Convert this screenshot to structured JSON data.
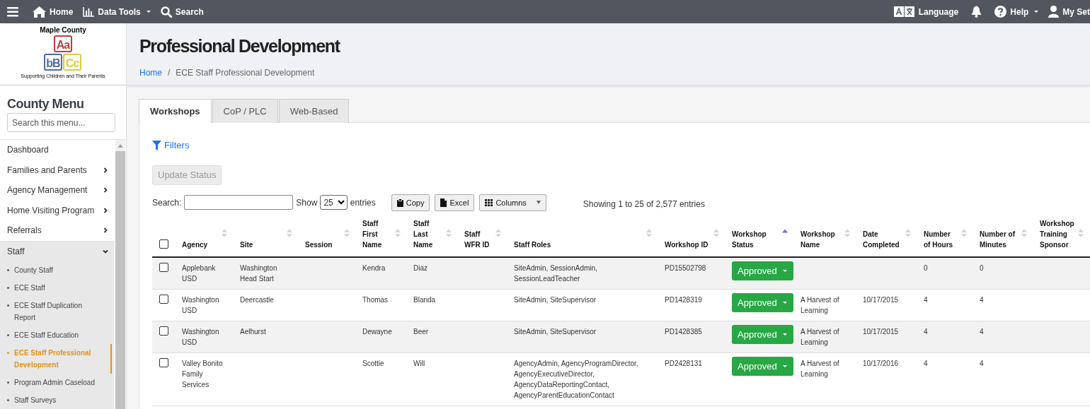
{
  "topbar": {
    "left": [
      {
        "kind": "home",
        "label": "Home",
        "dropdown": false
      },
      {
        "kind": "chart",
        "label": "Data Tools",
        "dropdown": true
      },
      {
        "kind": "search",
        "label": "Search",
        "dropdown": false
      }
    ],
    "right": [
      {
        "kind": "language",
        "label": "Language"
      },
      {
        "kind": "bell"
      },
      {
        "kind": "help",
        "label": "Help",
        "dropdown": true
      },
      {
        "kind": "user",
        "label": "My Set"
      }
    ]
  },
  "logo": {
    "name": "Maple County",
    "blocks": [
      {
        "text": "Aa",
        "color": "#b8413f"
      },
      {
        "text": "bB",
        "color": "#4b6aa8"
      },
      {
        "text": "Cc",
        "color": "#d6cf3c"
      }
    ],
    "tagline": "Supporting Children and Their Parents"
  },
  "sidebar": {
    "title": "County Menu",
    "search_placeholder": "Search this menu...",
    "items": [
      {
        "kind": "link",
        "label": "Dashboard"
      },
      {
        "kind": "group",
        "label": "Families and Parents",
        "expanded": false
      },
      {
        "kind": "group",
        "label": "Agency Management",
        "expanded": false
      },
      {
        "kind": "group",
        "label": "Home Visiting Program",
        "expanded": false
      },
      {
        "kind": "group",
        "label": "Referrals",
        "expanded": false
      },
      {
        "kind": "group",
        "label": "Staff",
        "expanded": true,
        "children": [
          {
            "label": "County Staff",
            "selected": false
          },
          {
            "label": "ECE Staff",
            "selected": false
          },
          {
            "label": "ECE Staff Duplication Report",
            "selected": false
          },
          {
            "label": "ECE Staff Education",
            "selected": false
          },
          {
            "label": "ECE Staff Professional Development",
            "selected": true
          },
          {
            "label": "Program Admin Caseload",
            "selected": false
          },
          {
            "label": "Staff Surveys",
            "selected": false
          }
        ]
      }
    ]
  },
  "page": {
    "title": "Professional Development",
    "separator": "/",
    "breadcrumb": [
      {
        "label": "Home",
        "link": true
      },
      {
        "label": "ECE Staff Professional Development",
        "link": false
      }
    ]
  },
  "tabs": [
    {
      "label": "Workshops",
      "selected": true
    },
    {
      "label": "CoP / PLC",
      "selected": false
    },
    {
      "label": "Web-Based",
      "selected": false
    }
  ],
  "filters": {
    "label": "Filters"
  },
  "update_button": {
    "label": "Update Status",
    "disabled": true
  },
  "toolbar": {
    "search_label": "Search:",
    "show_label": "Show",
    "page_size": "25",
    "entries_label": "entries",
    "buttons": [
      {
        "kind": "copy",
        "label": "Copy",
        "dropdown": false
      },
      {
        "kind": "excel",
        "label": "Excel",
        "dropdown": false
      },
      {
        "kind": "columns",
        "label": "Columns",
        "dropdown": true
      }
    ],
    "info": "Showing 1 to 25 of 2,577 entries"
  },
  "table": {
    "select_all_checked": false,
    "columns": [
      {
        "label": "Agency",
        "kind": "text",
        "sorted_ascending": false
      },
      {
        "label": "Site",
        "kind": "text",
        "sorted_ascending": false
      },
      {
        "label": "Session",
        "kind": "text",
        "sorted_ascending": false
      },
      {
        "label": "Staff First Name",
        "kind": "text",
        "sorted_ascending": false
      },
      {
        "label": "Staff Last Name",
        "kind": "text",
        "sorted_ascending": false
      },
      {
        "label": "Staff WFR ID",
        "kind": "text",
        "sorted_ascending": false
      },
      {
        "label": "Staff Roles",
        "kind": "text",
        "sorted_ascending": false
      },
      {
        "label": "Workshop ID",
        "kind": "text",
        "sorted_ascending": false
      },
      {
        "label": "Workshop Status",
        "kind": "status",
        "sorted_ascending": true
      },
      {
        "label": "Workshop Name",
        "kind": "text",
        "sorted_ascending": false
      },
      {
        "label": "Date Completed",
        "kind": "text",
        "sorted_ascending": false
      },
      {
        "label": "Number of Hours",
        "kind": "text",
        "sorted_ascending": false
      },
      {
        "label": "Number of Minutes",
        "kind": "text",
        "sorted_ascending": false
      },
      {
        "label": "Workshop Training Sponsor",
        "kind": "text",
        "sorted_ascending": false
      }
    ],
    "rows": [
      {
        "checked": false,
        "cells": [
          "Applebank USD",
          "Washington Head Start",
          null,
          "Kendra",
          "Diaz",
          null,
          "SiteAdmin, SessionAdmin, SessionLeadTeacher",
          "PD15502798",
          "Approved",
          null,
          null,
          "0",
          "0",
          null
        ]
      },
      {
        "checked": false,
        "cells": [
          "Washington USD",
          "Deercastle",
          null,
          "Thomas",
          "Blanda",
          null,
          "SiteAdmin, SiteSupervisor",
          "PD1428319",
          "Approved",
          "A Harvest of Learning",
          "10/17/2015",
          "4",
          "4",
          null
        ]
      },
      {
        "checked": false,
        "cells": [
          "Washington USD",
          "Aelhurst",
          null,
          "Dewayne",
          "Beer",
          null,
          "SiteAdmin, SiteSupervisor",
          "PD1428385",
          "Approved",
          "A Harvest of Learning",
          "10/17/2015",
          "4",
          "4",
          null
        ]
      },
      {
        "checked": false,
        "cells": [
          "Valley Bonito Family Services",
          null,
          null,
          "Scottie",
          "Will",
          null,
          "AgencyAdmin, AgencyProgramDirector, AgencyExecutiveDirector, AgencyDataReportingContact, AgencyParentEducationContact",
          "PD2428131",
          "Approved",
          "A Harvest of Learning",
          "10/17/2016",
          "4",
          "4",
          null
        ]
      }
    ]
  }
}
